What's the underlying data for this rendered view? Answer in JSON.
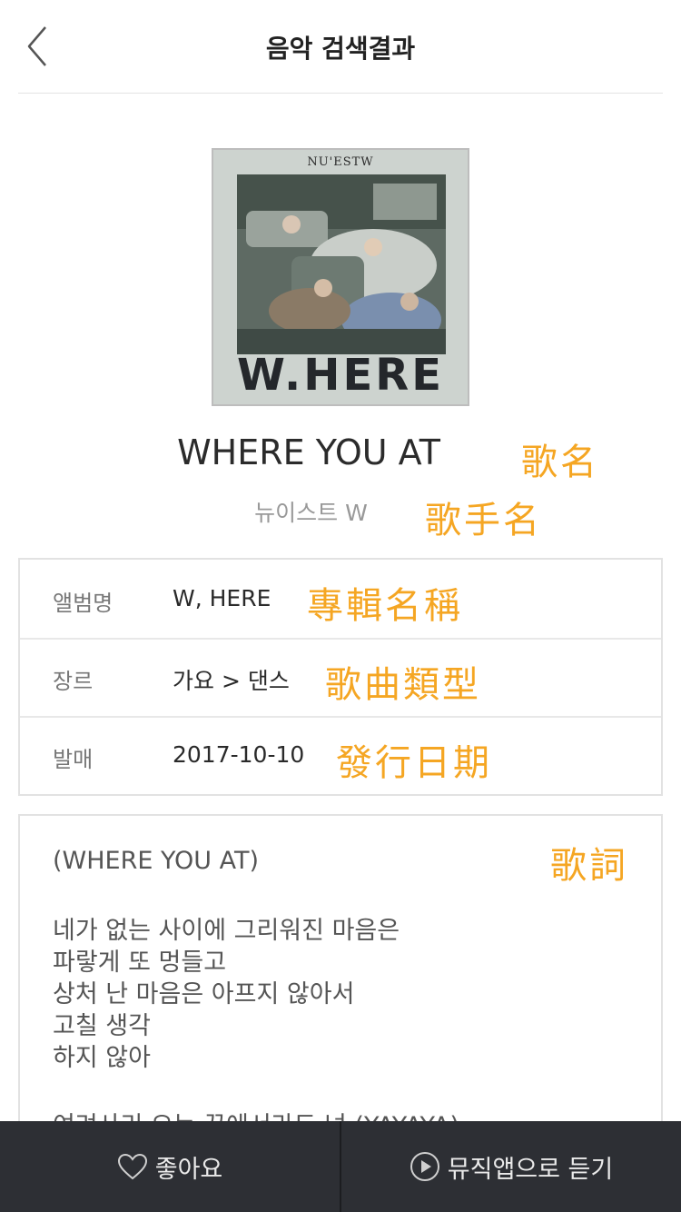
{
  "header": {
    "title": "음악 검색결과"
  },
  "album_cover": {
    "brand": "NU'ESTW",
    "title_word": "W.HERE"
  },
  "song": {
    "title": "WHERE YOU AT",
    "artist": "뉴이스트 W"
  },
  "annotations": {
    "song_name": "歌名",
    "artist_name": "歌手名",
    "album_name": "專輯名稱",
    "genre": "歌曲類型",
    "release_date": "發行日期",
    "lyrics": "歌詞",
    "color": "#f5a623"
  },
  "info": {
    "album_label": "앨범명",
    "album_value": "W, HERE",
    "genre_label": "장르",
    "genre_value": "가요 > 댄스",
    "release_label": "발매",
    "release_value": "2017-10-10"
  },
  "lyrics": {
    "heading": "(WHERE YOU AT)",
    "lines": [
      "네가 없는 사이에 그리워진 마음은",
      "파랗게 또 멍들고",
      "상처 난 마음은 아프지 않아서",
      "고칠 생각",
      "하지 않아",
      "",
      "여려사리 오는 꿈에서라도 넌 (YAYAYA)"
    ]
  },
  "bottom_bar": {
    "like_label": "좋아요",
    "listen_label": "뮤직앱으로 듣기"
  },
  "icons": {
    "back": "chevron-left-icon",
    "like": "heart-outline-icon",
    "listen": "play-circle-icon"
  }
}
